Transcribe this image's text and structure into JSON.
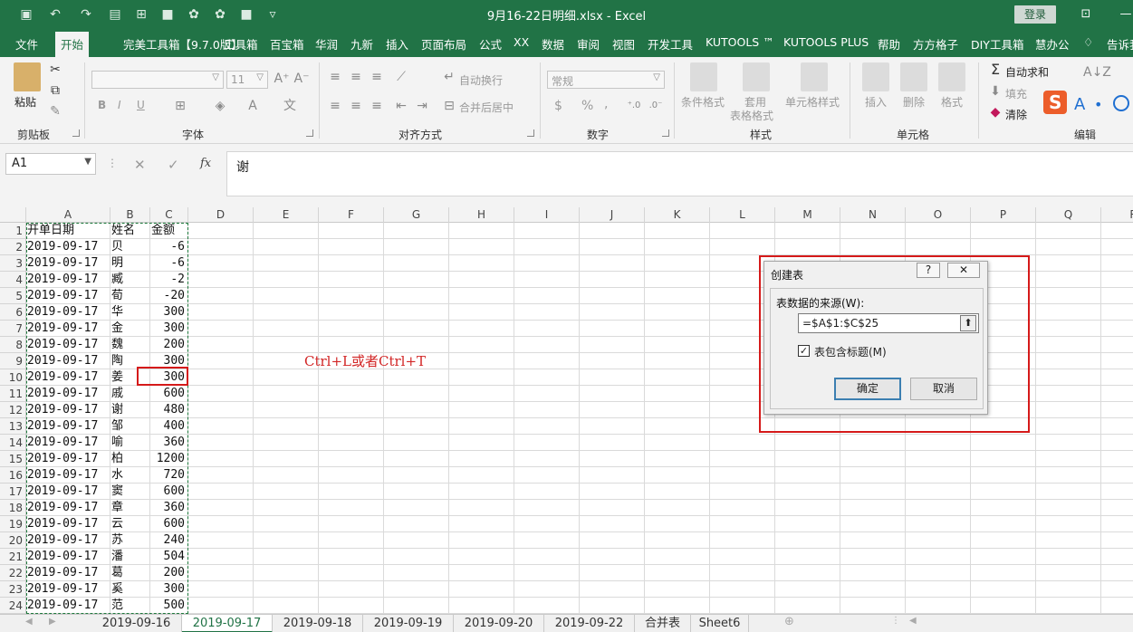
{
  "window": {
    "title": "9月16-22日明细.xlsx  -  Excel",
    "login": "登录"
  },
  "menu": [
    "文件",
    "开始",
    "完美工具箱【9.7.0版】",
    "工具箱",
    "百宝箱",
    "华润",
    "九新",
    "插入",
    "页面布局",
    "公式",
    "XX",
    "数据",
    "审阅",
    "视图",
    "开发工具",
    "KUTOOLS ™",
    "KUTOOLS PLUS",
    "帮助",
    "方方格子",
    "DIY工具箱",
    "慧办公",
    "告诉我"
  ],
  "ribbon": {
    "groups": [
      "剪贴板",
      "字体",
      "对齐方式",
      "数字",
      "样式",
      "单元格",
      "编辑"
    ],
    "paste": "粘贴",
    "font_size": "11",
    "wrap_text": "自动换行",
    "merge_center": "合并后居中",
    "number_format": "常规",
    "cond_format": "条件格式",
    "table_format_1": "套用",
    "table_format_2": "表格格式",
    "cell_style": "单元格样式",
    "insert": "插入",
    "delete": "删除",
    "format": "格式",
    "autosum": "自动求和",
    "fill": "填充",
    "clear": "清除",
    "bold": "B",
    "italic": "I",
    "underline": "U",
    "currency": "$",
    "percent": "%",
    "comma": ",",
    "inc_dec": ".0→.00",
    "dec_dec": ".00→.0"
  },
  "formula_bar": {
    "name_box": "A1",
    "value": "谢",
    "fx": "fx"
  },
  "columns": [
    "A",
    "B",
    "C",
    "D",
    "E",
    "F",
    "G",
    "H",
    "I",
    "J",
    "K",
    "L",
    "M",
    "N",
    "O",
    "P",
    "Q",
    "R"
  ],
  "rows": [
    "1",
    "2",
    "3",
    "4",
    "5",
    "6",
    "7",
    "8",
    "9",
    "10",
    "11",
    "12",
    "13",
    "14",
    "15",
    "16",
    "17",
    "18",
    "19",
    "20",
    "21",
    "22",
    "23",
    "24"
  ],
  "table": {
    "headers": [
      "开单日期",
      "姓名",
      "金额"
    ],
    "rows": [
      [
        "2019-09-17",
        "贝",
        "-6"
      ],
      [
        "2019-09-17",
        "明",
        "-6"
      ],
      [
        "2019-09-17",
        "臧",
        "-2"
      ],
      [
        "2019-09-17",
        "荀",
        "-20"
      ],
      [
        "2019-09-17",
        "华",
        "300"
      ],
      [
        "2019-09-17",
        "金",
        "300"
      ],
      [
        "2019-09-17",
        "魏",
        "200"
      ],
      [
        "2019-09-17",
        "陶",
        "300"
      ],
      [
        "2019-09-17",
        "姜",
        "300"
      ],
      [
        "2019-09-17",
        "戚",
        "600"
      ],
      [
        "2019-09-17",
        "谢",
        "480"
      ],
      [
        "2019-09-17",
        "邹",
        "400"
      ],
      [
        "2019-09-17",
        "喻",
        "360"
      ],
      [
        "2019-09-17",
        "柏",
        "1200"
      ],
      [
        "2019-09-17",
        "水",
        "720"
      ],
      [
        "2019-09-17",
        "窦",
        "600"
      ],
      [
        "2019-09-17",
        "章",
        "360"
      ],
      [
        "2019-09-17",
        "云",
        "600"
      ],
      [
        "2019-09-17",
        "苏",
        "240"
      ],
      [
        "2019-09-17",
        "潘",
        "504"
      ],
      [
        "2019-09-17",
        "葛",
        "200"
      ],
      [
        "2019-09-17",
        "奚",
        "300"
      ],
      [
        "2019-09-17",
        "范",
        "500"
      ]
    ]
  },
  "hint": "Ctrl+L或者Ctrl+T",
  "dialog": {
    "title": "创建表",
    "help": "?",
    "close": "✕",
    "source_label": "表数据的来源(W):",
    "range": "=$A$1:$C$25",
    "has_headers": "表包含标题(M)",
    "ok": "确定",
    "cancel": "取消"
  },
  "sheets": [
    "2019-09-16",
    "2019-09-17",
    "2019-09-18",
    "2019-09-19",
    "2019-09-20",
    "2019-09-22",
    "合并表",
    "Sheet6"
  ]
}
